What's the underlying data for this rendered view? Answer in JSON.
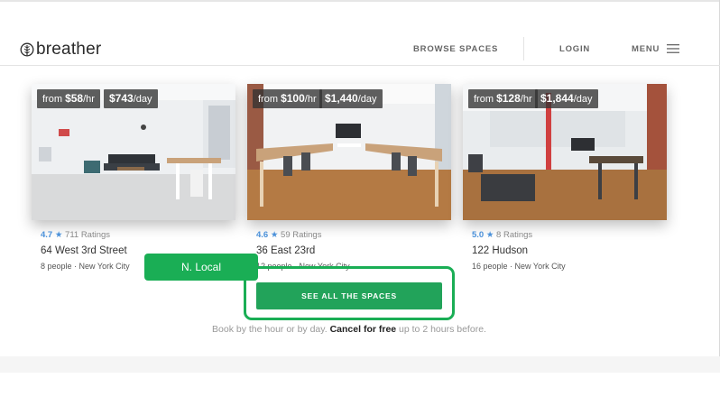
{
  "header": {
    "logo_text": "breather",
    "nav": {
      "browse": "BROWSE SPACES",
      "login": "LOGIN",
      "menu": "MENU"
    }
  },
  "listings": [
    {
      "price_from_prefix": "from",
      "hourly": "$58",
      "hourly_unit": "/hr",
      "daily": "$743",
      "daily_unit": "/day",
      "rating_score": "4.7",
      "rating_count": "711 Ratings",
      "address": "64 West 3rd Street",
      "capacity": "8 people",
      "city": "New York City"
    },
    {
      "price_from_prefix": "from",
      "hourly": "$100",
      "hourly_unit": "/hr",
      "daily": "$1,440",
      "daily_unit": "/day",
      "rating_score": "4.6",
      "rating_count": "59 Ratings",
      "address": "36 East 23rd",
      "capacity": "12 people",
      "city": "New York City"
    },
    {
      "price_from_prefix": "from",
      "hourly": "$128",
      "hourly_unit": "/hr",
      "daily": "$1,844",
      "daily_unit": "/day",
      "rating_score": "5.0",
      "rating_count": "8 Ratings",
      "address": "122 Hudson",
      "capacity": "16 people",
      "city": "New York City"
    }
  ],
  "overlay_label": "N. Local",
  "cta": {
    "label": "SEE ALL THE SPACES"
  },
  "tagline": {
    "lead": "Book by the hour or by day.",
    "bold": "Cancel for free",
    "tail": "up to 2 hours before."
  },
  "colors": {
    "accent_green": "#22a35a",
    "rating_blue": "#4a90d9",
    "price_tag_bg": "#323232"
  },
  "icons": {
    "logo": "tree-leaf-icon",
    "menu": "hamburger-icon",
    "star": "star-icon"
  }
}
